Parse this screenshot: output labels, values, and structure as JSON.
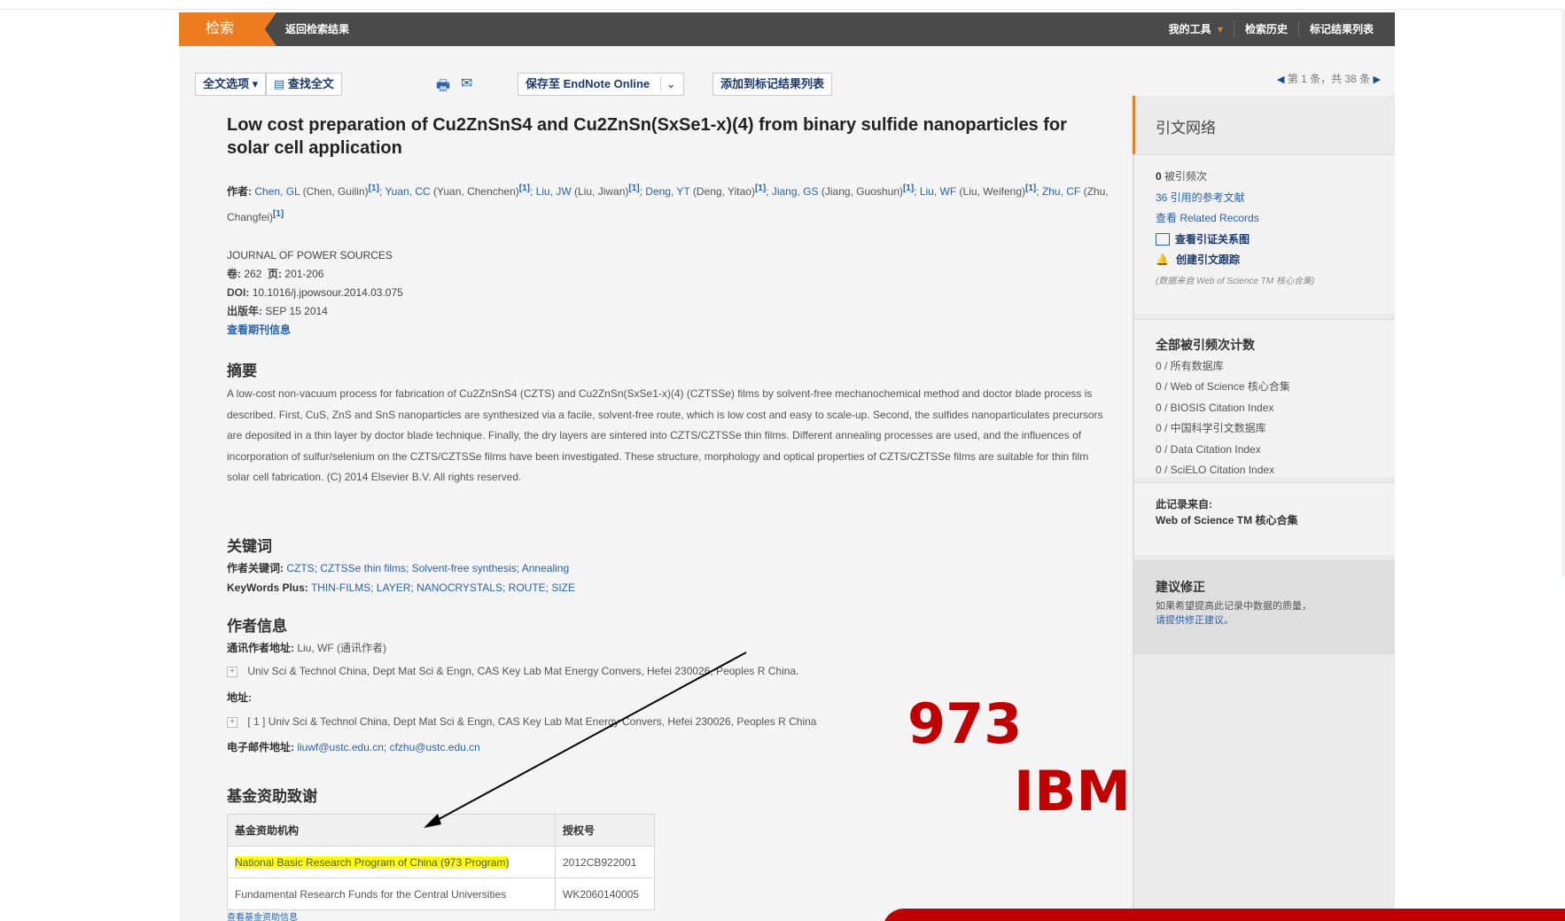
{
  "topbar": {
    "search_tab": "检索",
    "back_label": "返回检索结果",
    "my_tools": "我的工具",
    "history": "检索历史",
    "marked_list": "标记结果列表"
  },
  "toolbar": {
    "fulltext_options": "全文选项",
    "find_fulltext": "查找全文",
    "save_endnote": "保存至 EndNote Online",
    "add_marked": "添加到标记结果列表",
    "pager": "第 1 条，共 38 条"
  },
  "article": {
    "title": "Low cost preparation of Cu2ZnSnS4 and Cu2ZnSn(SxSe1-x)(4) from binary sulfide nanoparticles for solar cell application",
    "author_label": "作者:",
    "authors": [
      {
        "short": "Chen, GL",
        "full": "(Chen, Guilin)"
      },
      {
        "short": "Yuan, CC",
        "full": "(Yuan, Chenchen)"
      },
      {
        "short": "Liu, JW",
        "full": "(Liu, Jiwan)"
      },
      {
        "short": "Deng, YT",
        "full": "(Deng, Yitao)"
      },
      {
        "short": "Jiang, GS",
        "full": "(Jiang, Guoshun)"
      },
      {
        "short": "Liu, WF",
        "full": "(Liu, Weifeng)"
      },
      {
        "short": "Zhu, CF",
        "full": "(Zhu, Changfei)"
      }
    ],
    "aff_mark": "[1]",
    "journal": "JOURNAL OF POWER SOURCES",
    "volume_label": "卷:",
    "volume": "262",
    "pages_label": "页:",
    "pages": "201-206",
    "doi_label": "DOI:",
    "doi": "10.1016/j.jpowsour.2014.03.075",
    "pubdate_label": "出版年:",
    "pubdate": "SEP 15 2014",
    "journal_info_link": "查看期刊信息",
    "abstract_heading": "摘要",
    "abstract": "A low-cost non-vacuum process for fabrication of Cu2ZnSnS4 (CZTS) and Cu2ZnSn(SxSe1-x)(4) (CZTSSe) films by solvent-free mechanochemical method and doctor blade process is described. First, CuS, ZnS and SnS nanoparticles are synthesized via a facile, solvent-free route, which is low cost and easy to scale-up. Second, the sulfides nanoparticulates precursors are deposited in a thin layer by doctor blade technique. Finally, the dry layers are sintered into CZTS/CZTSSe thin films. Different annealing processes are used, and the influences of incorporation of sulfur/selenium on the CZTS/CZTSSe films have been investigated. These structure, morphology and optical properties of CZTS/CZTSSe films are suitable for thin film solar cell fabrication. (C) 2014 Elsevier B.V. All rights reserved.",
    "keywords_heading": "关键词",
    "author_kw_label": "作者关键词:",
    "author_kw": "CZTS; CZTSSe thin films; Solvent-free synthesis; Annealing",
    "kwplus_label": "KeyWords Plus:",
    "kwplus": "THIN-FILMS; LAYER; NANOCRYSTALS; ROUTE; SIZE",
    "author_info_heading": "作者信息",
    "reprint_label": "通讯作者地址:",
    "reprint": "Liu, WF (通讯作者)",
    "reprint_addr": "Univ Sci & Technol China, Dept Mat Sci & Engn, CAS Key Lab Mat Energy Convers, Hefei 230026, Peoples R China.",
    "addr_label": "地址:",
    "addr": "[ 1 ] Univ Sci & Technol China, Dept Mat Sci & Engn, CAS Key Lab Mat Energy Convers, Hefei 230026, Peoples R China",
    "email_label": "电子邮件地址:",
    "email": "liuwf@ustc.edu.cn; cfzhu@ustc.edu.cn",
    "funding_heading": "基金资助致谢",
    "funding_cols": [
      "基金资助机构",
      "授权号"
    ],
    "funding_rows": [
      {
        "agency": "National Basic Research Program of China (973 Program)",
        "grant": "2012CB922001"
      },
      {
        "agency": "Fundamental Research Funds for the Central Universities",
        "grant": "WK2060140005"
      }
    ],
    "funding_more": "查看基金资助信息"
  },
  "sidebar": {
    "citation_network": "引文网络",
    "times_cited_num": "0",
    "times_cited": "被引频次",
    "refs": "36 引用的参考文献",
    "related": "查看 Related Records",
    "cite_map": "查看引证关系图",
    "alert": "创建引文跟踪",
    "note": "(数据来自 Web of Science TM 核心合集)",
    "all_counts_heading": "全部被引频次计数",
    "counts": [
      "0 / 所有数据库",
      "0 / Web of Science 核心合集",
      "0 / BIOSIS Citation Index",
      "0 / 中国科学引文数据库",
      "0 / Data Citation Index",
      "0 / SciELO Citation Index"
    ],
    "record_from_label": "此记录来自:",
    "record_from": "Web of Science TM 核心合集",
    "suggest_heading": "建议修正",
    "suggest_text1": "如果希望提高此记录中数据的质量，",
    "suggest_text2": "请提供修正建议。"
  },
  "annotations": {
    "label_973": "973",
    "label_ibm": "IBM",
    "arrow_color": "#000000",
    "label_color": "#c00000"
  }
}
